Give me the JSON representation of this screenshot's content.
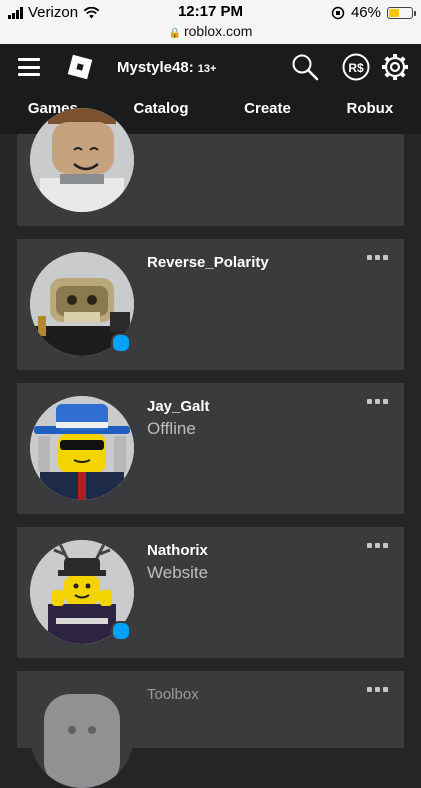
{
  "status_bar": {
    "carrier": "Verizon",
    "time": "12:17 PM",
    "url": "roblox.com",
    "battery": "46%",
    "battery_level": 0.46
  },
  "header": {
    "username": "Mystyle48:",
    "age_badge": "13+",
    "icons": [
      "hamburger-menu-icon",
      "roblox-logo-icon",
      "search-icon",
      "robux-icon",
      "gear-icon"
    ]
  },
  "nav": {
    "tabs": [
      "Games",
      "Catalog",
      "Create",
      "Robux"
    ]
  },
  "friends": [
    {
      "name": "",
      "status": ""
    },
    {
      "name": "Reverse_Polarity",
      "status": "",
      "online": true
    },
    {
      "name": "Jay_Galt",
      "status": "Offline",
      "online": false
    },
    {
      "name": "Nathorix",
      "status": "Website",
      "online": true
    },
    {
      "name": "Toolbox",
      "status": ""
    }
  ],
  "colors": {
    "background": "#232527",
    "card": "#393b3d",
    "header": "#191b1d",
    "presence_online": "#00a2ff"
  }
}
